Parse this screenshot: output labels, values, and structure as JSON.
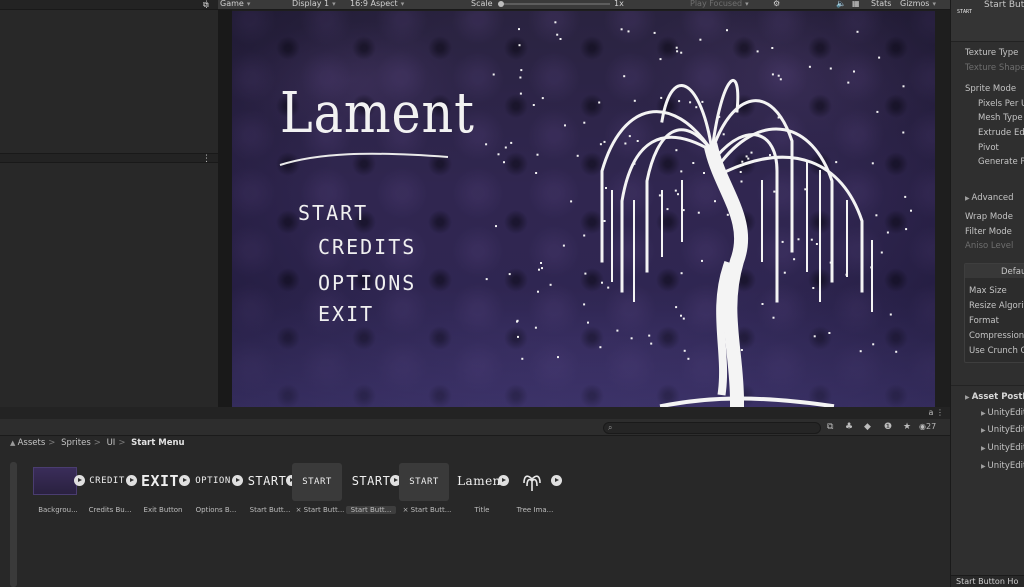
{
  "game_toolbar": {
    "tab": "Game",
    "display": "Display 1",
    "aspect": "16:9 Aspect",
    "scale_label": "Scale",
    "scale_value": "1x",
    "play_mode": "Play Focused",
    "stats": "Stats",
    "gizmos": "Gizmos"
  },
  "game": {
    "title": "Lament",
    "menu": [
      "START",
      "CREDITS",
      "OPTIONS",
      "EXIT"
    ]
  },
  "inspector": {
    "thumb_text": "START",
    "object_name": "Start Butt",
    "rows": [
      {
        "label": "Texture Type",
        "dim": false
      },
      {
        "label": "Texture Shape",
        "dim": true
      },
      {
        "label": "Sprite Mode",
        "dim": false
      },
      {
        "label": "Pixels Per U",
        "dim": false
      },
      {
        "label": "Mesh Type",
        "dim": false
      },
      {
        "label": "Extrude Edg",
        "dim": false
      },
      {
        "label": "Pivot",
        "dim": false
      },
      {
        "label": "Generate P",
        "dim": false
      },
      {
        "label": "Advanced",
        "dim": false
      },
      {
        "label": "Wrap Mode",
        "dim": false
      },
      {
        "label": "Filter Mode",
        "dim": false
      },
      {
        "label": "Aniso Level",
        "dim": true
      },
      {
        "label": "Defau",
        "dim": false
      },
      {
        "label": "Max Size",
        "dim": false
      },
      {
        "label": "Resize Algorit",
        "dim": false
      },
      {
        "label": "Format",
        "dim": false
      },
      {
        "label": "Compression",
        "dim": false
      },
      {
        "label": "Use Crunch C",
        "dim": false
      },
      {
        "label": "Asset PostPro",
        "dim": false
      },
      {
        "label": "UnityEdito",
        "dim": false
      },
      {
        "label": "UnityEdito",
        "dim": false
      },
      {
        "label": "UnityEdito",
        "dim": false
      },
      {
        "label": "UnityEdito",
        "dim": false
      }
    ],
    "footer": "Start Button Ho"
  },
  "project": {
    "breadcrumbs": [
      "Assets",
      "Sprites",
      "UI",
      "Start Menu"
    ],
    "hidden_count": "27",
    "assets": [
      {
        "thumb": "",
        "label": "Backgrou..."
      },
      {
        "thumb": "CREDIT",
        "label": "Credits Bu..."
      },
      {
        "thumb": "EXIT",
        "label": "Exit Button"
      },
      {
        "thumb": "OPTION",
        "label": "Options B..."
      },
      {
        "thumb": "START",
        "label": "Start Butt..."
      },
      {
        "thumb": "START",
        "label": "× Start Butt..."
      },
      {
        "thumb": "START",
        "label": "Start Butt..."
      },
      {
        "thumb": "START",
        "label": "× Start Butt..."
      },
      {
        "thumb": "Lamen",
        "label": "Title"
      },
      {
        "thumb": "",
        "label": "Tree Ima..."
      }
    ]
  },
  "colors": {
    "editor_bg": "#282828",
    "toolbar_bg": "#3a3a3a",
    "game_bg": "#2f2652",
    "text_light": "#f0f0f0"
  }
}
